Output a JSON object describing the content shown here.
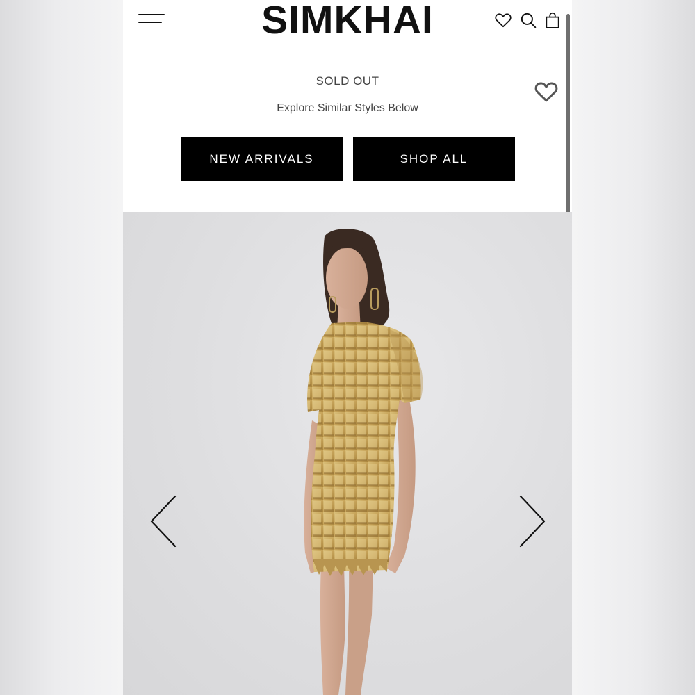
{
  "brand": {
    "name": "SIMKHAI"
  },
  "header": {
    "menu_icon": "hamburger-icon",
    "icons": [
      "heart-icon",
      "search-icon",
      "shopping-bag-icon"
    ]
  },
  "product": {
    "status": "SOLD OUT",
    "message": "Explore Similar Styles Below",
    "wishlist_icon": "heart-icon"
  },
  "actions": {
    "new_arrivals": "NEW ARRIVALS",
    "shop_all": "SHOP ALL"
  },
  "gallery": {
    "prev_icon": "chevron-left-icon",
    "next_icon": "chevron-right-icon",
    "image": "model in gold paillette mini dress"
  },
  "colors": {
    "accent": "#000000",
    "dress": "#c9a85c",
    "background": "#dedee0"
  }
}
